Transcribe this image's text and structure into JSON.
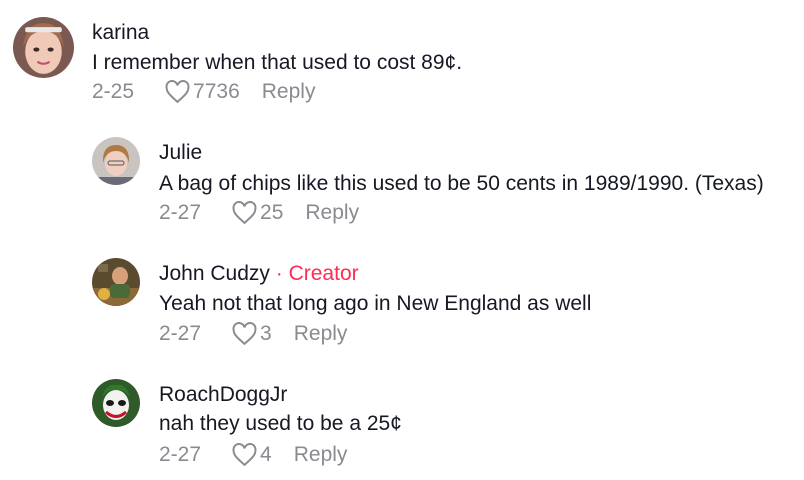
{
  "comments": [
    {
      "username": "karina",
      "text": "I remember when that used to cost 89¢.",
      "date": "2-25",
      "likes": "7736",
      "reply_label": "Reply"
    },
    {
      "username": "Julie",
      "text": "A bag of chips like this used to be 50 cents in 1989/1990. (Texas)",
      "date": "2-27",
      "likes": "25",
      "reply_label": "Reply"
    },
    {
      "username": "John Cudzy",
      "creator_separator": "·",
      "creator_label": "Creator",
      "text": "Yeah not that long ago in New England as well",
      "date": "2-27",
      "likes": "3",
      "reply_label": "Reply"
    },
    {
      "username": "RoachDoggJr",
      "text": "nah they used to be a 25¢",
      "date": "2-27",
      "likes": "4",
      "reply_label": "Reply"
    }
  ],
  "colors": {
    "text": "#161823",
    "secondary": "#8a8b91",
    "creator": "#fe2c55"
  }
}
